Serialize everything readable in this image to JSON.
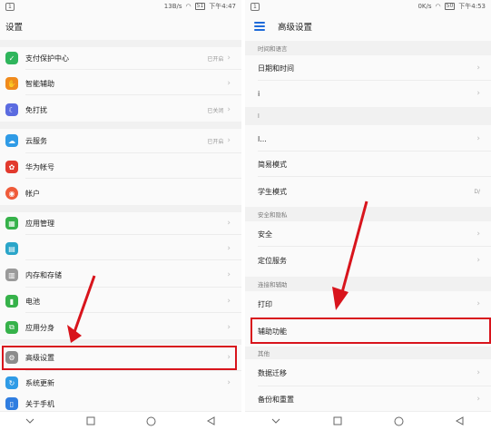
{
  "left": {
    "status": {
      "sim": "1",
      "speed": "13B/s",
      "battery": "51",
      "time": "下午4:47"
    },
    "title": "设置",
    "items": [
      {
        "label": "支付保护中心",
        "value": "已开启",
        "icon": "shield-icon",
        "color": "#2fb55c"
      },
      {
        "label": "智能辅助",
        "value": "",
        "icon": "hand-icon",
        "color": "#f08a1c"
      },
      {
        "label": "免打扰",
        "value": "已关闭",
        "icon": "moon-icon",
        "color": "#5b6be0"
      },
      {
        "label": "云服务",
        "value": "已开启",
        "icon": "cloud-icon",
        "color": "#2f9be6"
      },
      {
        "label": "华为帐号",
        "value": "",
        "icon": "huawei-icon",
        "color": "#e23a2e"
      },
      {
        "label": "帐户",
        "value": "",
        "icon": "account-icon",
        "color": "#ef5b3a"
      },
      {
        "label": "应用管理",
        "value": "",
        "icon": "apps-icon",
        "color": "#36b24a"
      },
      {
        "label": "",
        "value": "",
        "icon": "grid-icon",
        "color": "#2aa5c9"
      },
      {
        "label": "",
        "value": "",
        "icon": "blank-icon",
        "color": "#46b25a"
      },
      {
        "label": "内存和存储",
        "value": "",
        "icon": "storage-icon",
        "color": "#9a9a9a"
      },
      {
        "label": "电池",
        "value": "",
        "icon": "battery-icon",
        "color": "#36b24a"
      },
      {
        "label": "应用分身",
        "value": "",
        "icon": "twin-icon",
        "color": "#36b24a"
      },
      {
        "label": "高级设置",
        "value": "",
        "icon": "gear-icon",
        "color": "#8c8c8c"
      },
      {
        "label": "系统更新",
        "value": "",
        "icon": "update-icon",
        "color": "#2f9be6"
      },
      {
        "label": "关于手机",
        "value": "",
        "icon": "phone-icon",
        "color": "#2f7de0"
      }
    ]
  },
  "right": {
    "status": {
      "sim": "1",
      "speed": "0K/s",
      "battery": "50",
      "time": "下午4:53"
    },
    "title": "高级设置",
    "sections": {
      "time_lang": "时间和语言",
      "security": "安全和隐私",
      "connect": "连接和辅助",
      "other": "其他"
    },
    "items": {
      "datetime": "日期和时间",
      "lang": "i",
      "input_header": "l",
      "input": "l...",
      "simple_mode": "简易模式",
      "student_mode": "学生模式",
      "student_value": "D/",
      "security": "安全",
      "location": "定位服务",
      "print": "打印",
      "accessibility": "辅助功能",
      "migrate": "数据迁移",
      "backup": "备份和重置"
    }
  },
  "colors": {
    "highlight": "#d8141c",
    "accent": "#1e6ad9"
  }
}
